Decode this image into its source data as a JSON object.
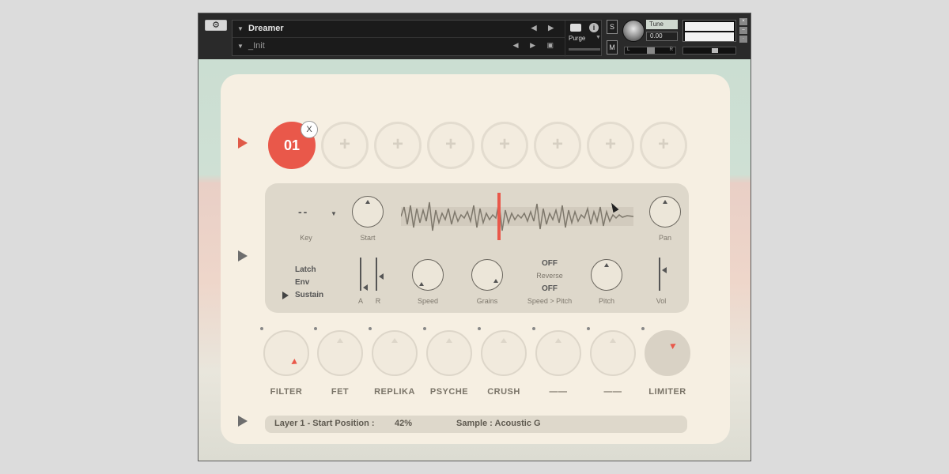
{
  "header": {
    "instrument_name": "Dreamer",
    "snapshot_name": "_Init",
    "purge_label": "Purge",
    "solo_label": "S",
    "mute_label": "M",
    "tune_label": "Tune",
    "tune_value": "0.00",
    "pan_left": "L",
    "pan_right": "R",
    "info_label": "i"
  },
  "layers": {
    "active_label": "01",
    "remove_label": "X",
    "add_label": "+"
  },
  "sample": {
    "key_value": "--",
    "key_label": "Key",
    "start_label": "Start",
    "pan_label": "Pan",
    "modes": [
      "Latch",
      "Env",
      "Sustain"
    ],
    "selected_mode": "Sustain",
    "attack_label": "A",
    "release_label": "R",
    "speed_label": "Speed",
    "grains_label": "Grains",
    "reverse_value": "OFF",
    "reverse_label": "Reverse",
    "speed_pitch_value": "OFF",
    "speed_pitch_label": "Speed > Pitch",
    "pitch_label": "Pitch",
    "vol_label": "Vol"
  },
  "effects": [
    "FILTER",
    "FET",
    "REPLIKA",
    "PSYCHE",
    "CRUSH",
    "——",
    "——",
    "LIMITER"
  ],
  "status": {
    "param": "Layer 1 - Start Position :",
    "value": "42%",
    "sample_text": "Sample : Acoustic G"
  },
  "colors": {
    "accent": "#e9584a",
    "panel": "#f6efe2",
    "sample_box": "#ded8cb"
  }
}
